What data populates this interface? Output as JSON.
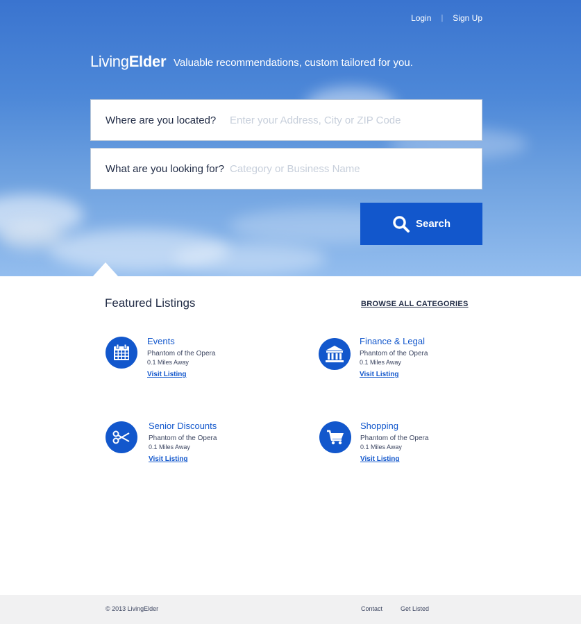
{
  "topnav": {
    "login": "Login",
    "separator": "|",
    "signup": "Sign Up"
  },
  "brand": {
    "logo_light": "Living",
    "logo_bold": "Elder",
    "tagline": "Valuable recommendations, custom tailored for you."
  },
  "search": {
    "location_label": "Where are you located?",
    "location_placeholder": "Enter your Address, City or ZIP Code",
    "query_label": "What are you looking for?",
    "query_placeholder": "Category or Business Name",
    "button_label": "Search"
  },
  "featured": {
    "title": "Featured Listings",
    "browse_all": "BROWSE ALL CATEGORIES",
    "listings": [
      {
        "category": "Events",
        "name": "Phantom of the Opera",
        "distance": "0.1 Miles Away",
        "link": "Visit Listing",
        "icon": "calendar-icon"
      },
      {
        "category": "Finance & Legal",
        "name": "Phantom of the Opera",
        "distance": "0.1 Miles Away",
        "link": "Visit Listing",
        "icon": "bank-icon"
      },
      {
        "category": "Senior Discounts",
        "name": "Phantom of the Opera",
        "distance": "0.1 Miles Away",
        "link": "Visit Listing",
        "icon": "scissors-icon"
      },
      {
        "category": "Shopping",
        "name": "Phantom of the Opera",
        "distance": "0.1 Miles Away",
        "link": "Visit Listing",
        "icon": "cart-icon"
      }
    ]
  },
  "footer": {
    "copyright": "© 2013 LivingElder",
    "contact": "Contact",
    "get_listed": "Get Listed"
  },
  "colors": {
    "primary": "#1257cc",
    "sky_top": "#3a74cf",
    "sky_bottom": "#93bdee",
    "footer_bg": "#f1f1f2"
  }
}
